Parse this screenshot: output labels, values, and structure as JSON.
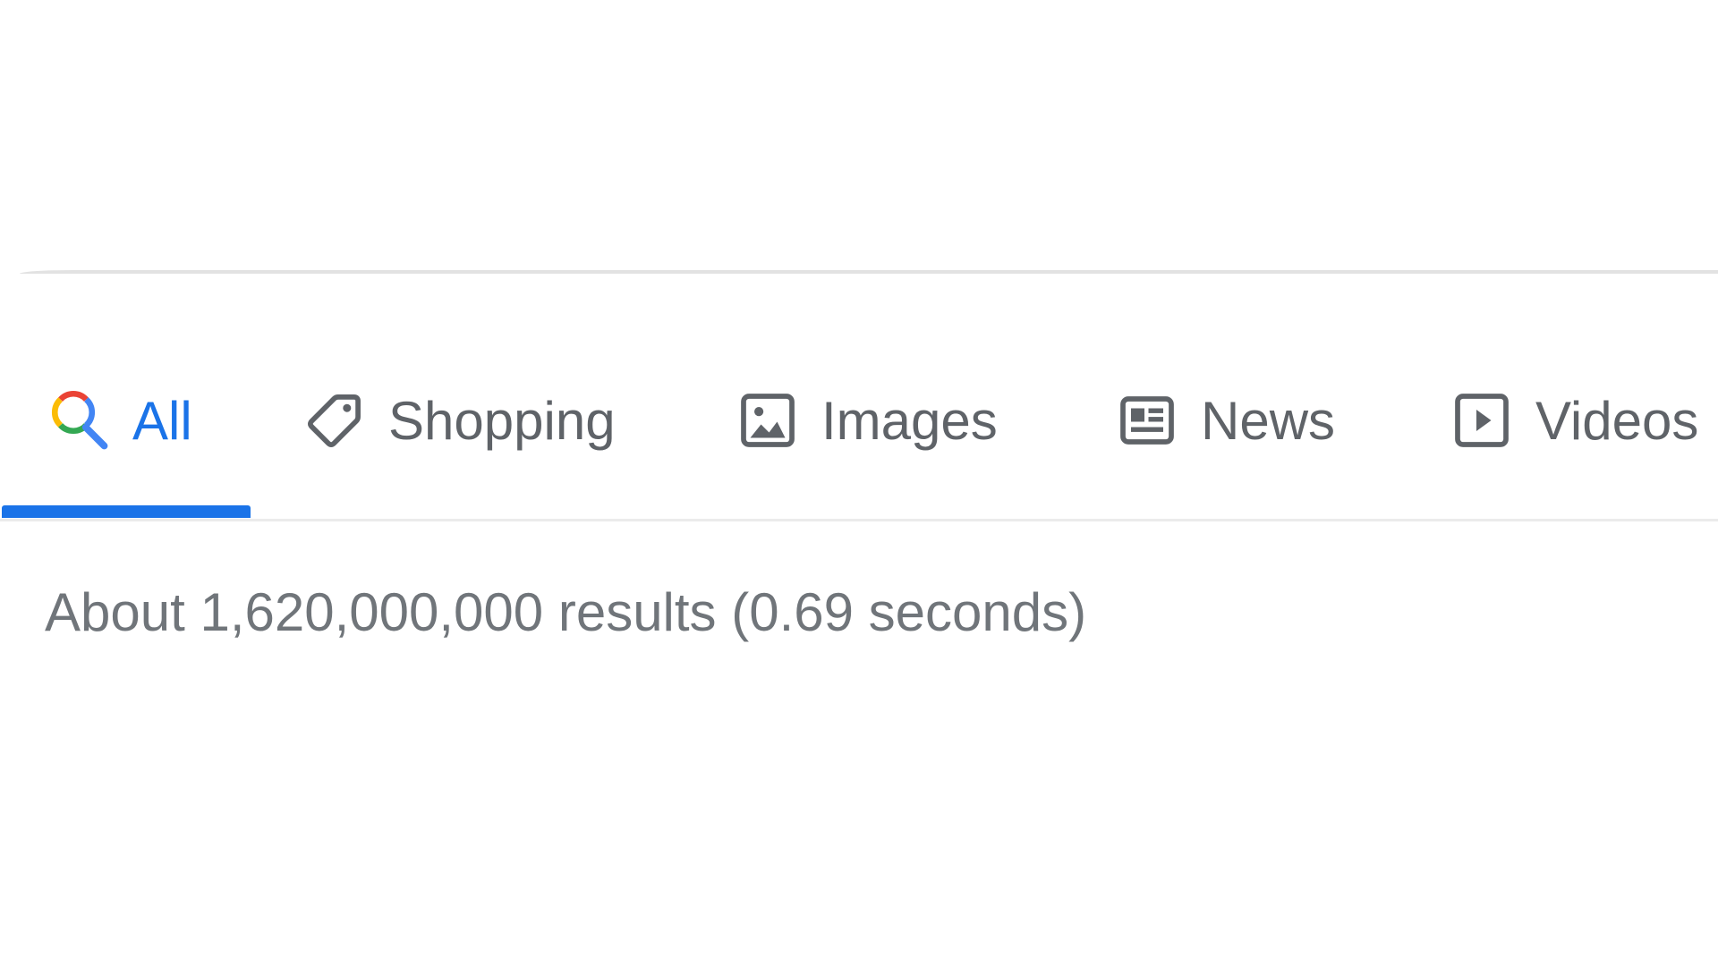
{
  "tabs": [
    {
      "label": "All",
      "icon": "search-icon",
      "active": true
    },
    {
      "label": "Shopping",
      "icon": "tag-icon",
      "active": false
    },
    {
      "label": "Images",
      "icon": "image-icon",
      "active": false
    },
    {
      "label": "News",
      "icon": "news-icon",
      "active": false
    },
    {
      "label": "Videos",
      "icon": "play-icon",
      "active": false
    }
  ],
  "results": {
    "stats": "About 1,620,000,000 results (0.69 seconds)"
  },
  "colors": {
    "active_tab": "#1a73e8",
    "inactive_tab": "#5f6368",
    "stats_text": "#70757a",
    "google_blue": "#4285f4",
    "google_red": "#ea4335",
    "google_yellow": "#fbbc05",
    "google_green": "#34a853"
  }
}
